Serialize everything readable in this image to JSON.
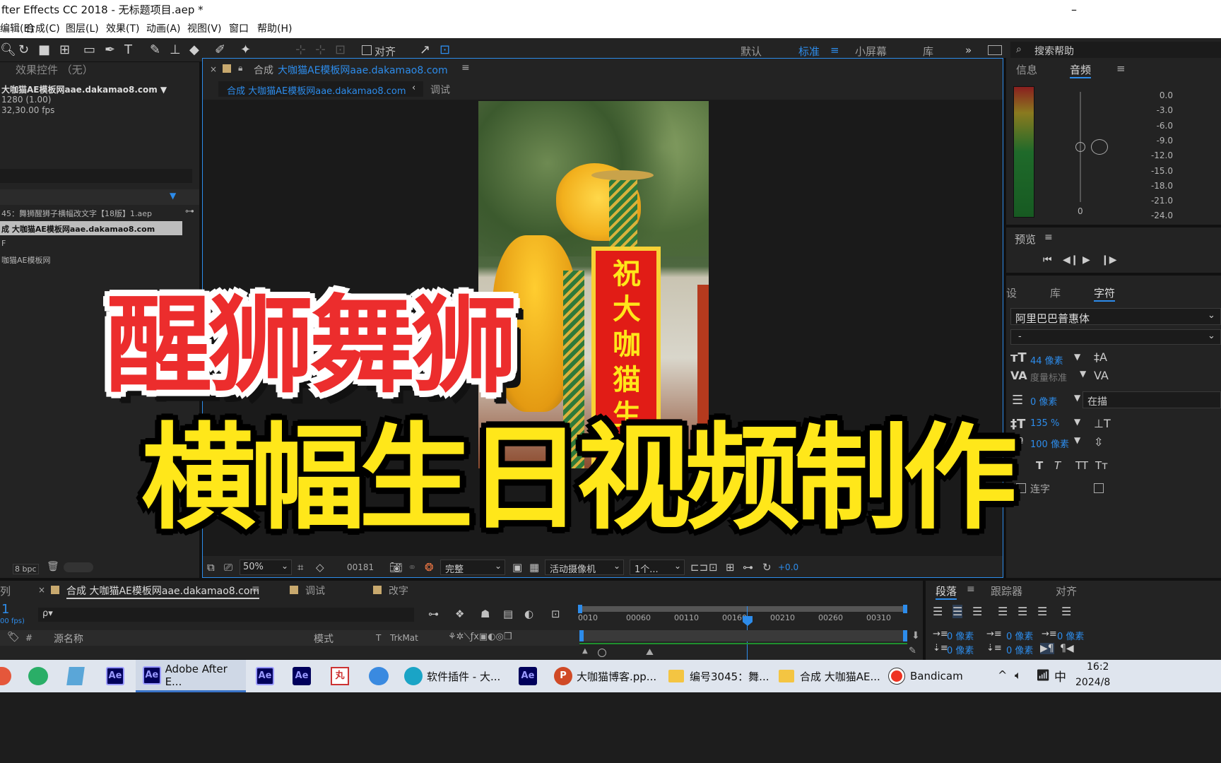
{
  "window": {
    "title": "fter Effects CC 2018 - 无标题项目.aep *",
    "minimize_glyph": "–"
  },
  "menu": {
    "items": [
      "编辑(E)",
      "合成(C)",
      "图层(L)",
      "效果(T)",
      "动画(A)",
      "视图(V)",
      "窗口",
      "帮助(H)"
    ]
  },
  "toolbar": {
    "align_label": "对齐",
    "workspaces": [
      "默认",
      "标准",
      "小屏幕",
      "库"
    ],
    "active_workspace": "标准",
    "search_placeholder": "搜索帮助",
    "more_glyph": "»"
  },
  "effects_panel": {
    "title": "效果控件 （无）"
  },
  "project": {
    "comp_name": "大咖猫AE模板网aae.dakamao8.com ▼",
    "comp_size": "1280 (1.00)",
    "comp_duration": "32,30.00 fps",
    "items": [
      "45：舞狮醒狮子横幅改文字【18版】1.aep",
      "成 大咖猫AE模板网aae.dakamao8.com",
      "F",
      "咖猫AE模板网"
    ],
    "bpc": "8 bpc"
  },
  "composition": {
    "tab_title": "合成 大咖猫AE模板网aae.dakamao8.com",
    "tab_prefix": "合成",
    "breadcrumb_active": "合成 大咖猫AE模板网aae.dakamao8.com",
    "breadcrumb_other": "调试",
    "zoom": "50%",
    "timecode": "00181",
    "resolution": "完整",
    "camera": "活动摄像机",
    "views": "1个...",
    "exposure": "+0.0"
  },
  "overlay": {
    "line1": "醒狮舞狮",
    "line2": "横幅生日视频制作",
    "banner_text": "祝大咖猫生日"
  },
  "info_panel": {
    "tab_info": "信息",
    "tab_audio": "音频",
    "meter_ticks": [
      "0.0",
      "-3.0",
      "-6.0",
      "-9.0",
      "-12.0",
      "-15.0",
      "-18.0",
      "-21.0",
      "-24.0"
    ],
    "slider_zero": "0"
  },
  "preview_panel": {
    "title": "预览"
  },
  "character_panel": {
    "tabs": [
      "设",
      "库",
      "字符"
    ],
    "font": "阿里巴巴普惠体",
    "style": "-",
    "size": "44 像素",
    "kerning": "度量标准",
    "stroke": "0 像素",
    "stroke_type": "在描",
    "leading": "135 %",
    "tracking": "100 像素",
    "faux_styles": [
      "T",
      "T",
      "TT",
      "Tт"
    ],
    "ligature": "连字"
  },
  "timeline": {
    "tabs": [
      "合成 大咖猫AE模板网aae.dakamao8.com",
      "调试",
      "改字"
    ],
    "left_stub": "列",
    "timecode": "1",
    "fps": "00 fps)",
    "search_placeholder": "ρ▾",
    "columns": [
      "#",
      "源名称",
      "模式",
      "T",
      "TrkMat"
    ],
    "ruler": [
      "0010",
      "00060",
      "00110",
      "00160",
      "00210",
      "00260",
      "00310"
    ]
  },
  "paragraph_panel": {
    "tabs": [
      "段落",
      "跟踪器",
      "对齐"
    ],
    "indents": [
      "0 像素",
      "0 像素",
      "0 像素",
      "0 像素",
      "0 像素",
      "0 像素"
    ]
  },
  "taskbar": {
    "items": [
      "Adobe After E...",
      "软件插件 - 大...",
      "大咖猫博客.pp...",
      "编号3045：舞...",
      "合成 大咖猫AE...",
      "Bandicam"
    ],
    "ime": "中",
    "time": "16:2",
    "date": "2024/8"
  },
  "colors": {
    "accent": "#2d8ceb",
    "red": "#ec2d2d",
    "yellow": "#ffe71a",
    "panel": "#232323"
  }
}
